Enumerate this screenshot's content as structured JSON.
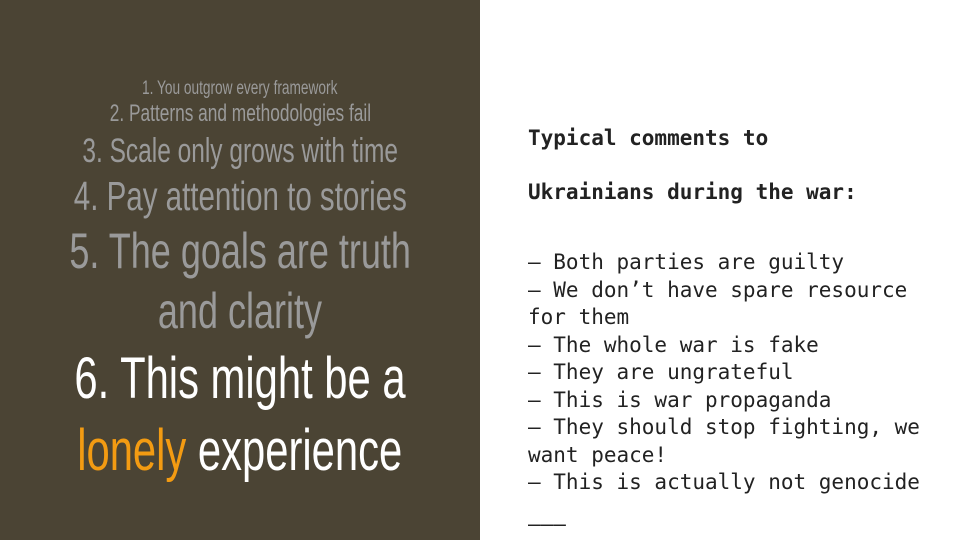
{
  "left_panel": {
    "items": [
      "1. You outgrow every framework",
      "2. Patterns and methodologies fail",
      "3. Scale only grows with time",
      "4. Pay attention to stories",
      "5. The goals are truth",
      "and clarity",
      "6. This might be a",
      "lonely",
      "experience"
    ],
    "colors": {
      "background": "#4b4434",
      "muted_text": "#9a9a9a",
      "highlight_text": "#ffffff",
      "accent": "#f39b12"
    }
  },
  "right_panel": {
    "heading_line1": "Typical comments to",
    "heading_line2": "Ukrainians during the war:",
    "comments": [
      "— Both parties are guilty",
      "— We don’t have spare resource for them",
      "— The whole war is fake",
      "— They are ungrateful",
      "— This is war propaganda",
      "— They should stop fighting, we want peace!",
      "— This is actually not genocide"
    ],
    "trailer": "———"
  }
}
